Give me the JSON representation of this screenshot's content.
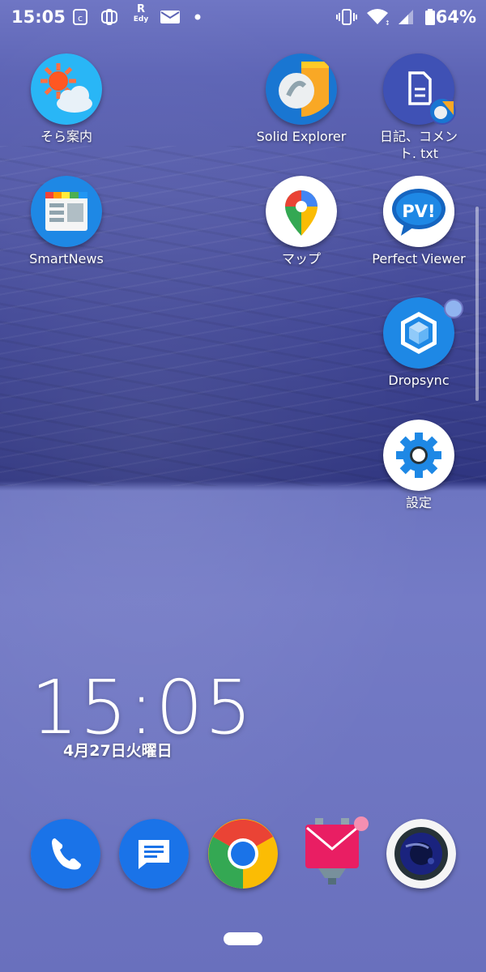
{
  "status_bar": {
    "time": "15:05",
    "battery": "64%",
    "left_icons": [
      "c-icon",
      "pay-icon",
      "edy-icon",
      "mail-icon",
      "dot-icon"
    ],
    "edy_top": "R",
    "edy_bottom": "Edy",
    "right_icons": [
      "vibrate-icon",
      "wifi-icon",
      "signal-icon",
      "battery-icon"
    ]
  },
  "apps": {
    "sora": "そら案内",
    "solid": "Solid Explorer",
    "diary_line1": "日記、コメン",
    "diary_line2": "ト. txt",
    "smartnews": "SmartNews",
    "maps": "マップ",
    "perfect_viewer": "Perfect Viewer",
    "pv_logo": "PV!",
    "dropsync": "Dropsync",
    "settings": "設定"
  },
  "clock": {
    "time": "15:05",
    "date": "4月27日火曜日"
  },
  "dock": [
    "phone-icon",
    "messages-icon",
    "chrome-icon",
    "mail-icon",
    "camera-icon"
  ],
  "colors": {
    "accent_blue": "#1a73e8",
    "badge": "#f48fb1"
  }
}
